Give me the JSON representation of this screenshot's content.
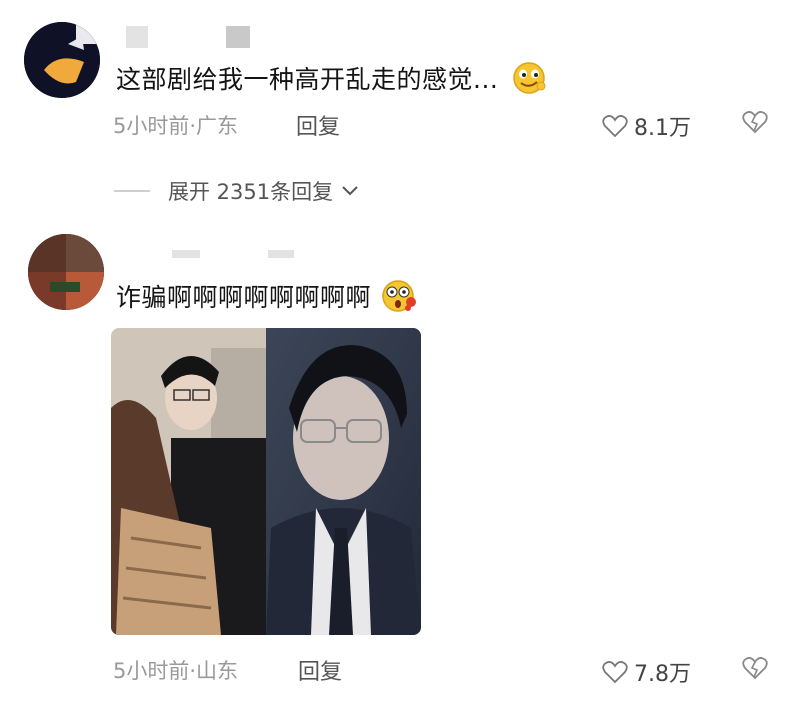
{
  "comments": [
    {
      "text": "这部剧给我一种高开乱走的感觉...",
      "emoji": "smirk-emoji-icon",
      "time_location": "5小时前·广东",
      "reply_label": "回复",
      "likes": "8.1万",
      "expand_label": "展开 2351条回复"
    },
    {
      "text": "诈骗啊啊啊啊啊啊啊啊",
      "emoji": "shocked-bleeding-emoji-icon",
      "time_location": "5小时前·山东",
      "reply_label": "回复",
      "likes": "7.8万",
      "image": "actor-collage-photo"
    }
  ],
  "colors": {
    "meta": "#9a9a9a",
    "text": "#141414",
    "emoji_yellow": "#f7c531"
  }
}
